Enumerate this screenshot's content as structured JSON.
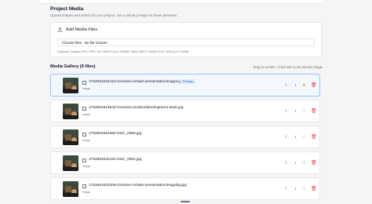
{
  "section": {
    "title": "Project Media",
    "subtitle": "Upload images and videos for your project. Set a primary image for hover previews."
  },
  "upload": {
    "title": "Add Media Files",
    "button_label": "Choose files",
    "no_file_text": "No file chosen",
    "supports": "Supports: Images (JPG, PNG, GIF, WebP) up to 100MB, videos (MP4, WebM, MOV, AVI) up to 100MB"
  },
  "gallery": {
    "title": "Media Gallery (9 files)",
    "hint": "Drag to reorder • Click star to set primary image",
    "primary_label": "Primary",
    "items": [
      {
        "filename": "1752661631416-Gmeiner-inhaler-presentationimages.jpg",
        "type": "image",
        "primary": true
      },
      {
        "filename": "1752661624642-Gmeiner-product/development-desk.jpg",
        "type": "image",
        "primary": false
      },
      {
        "filename": "1752661631682-DSC_0059.jpg",
        "type": "image",
        "primary": false
      },
      {
        "filename": "1752661632191-DSC_0064.jpg",
        "type": "image",
        "primary": false
      },
      {
        "filename": "1752661632208-Gmeiner-inhaler-presentationimagebg.jpg",
        "type": "image",
        "primary": false
      }
    ]
  },
  "icons": {
    "upload": "upload-icon",
    "drag": "drag-handle-icon",
    "image": "image-icon",
    "move_up": "arrow-up-icon",
    "move_down": "arrow-down-icon",
    "star": "star-icon",
    "delete": "trash-icon"
  },
  "colors": {
    "primary_star": "#f59e0b",
    "delete": "#ef4444",
    "primary_badge": "#dbeafe",
    "primary_border": "#93c5fd"
  }
}
